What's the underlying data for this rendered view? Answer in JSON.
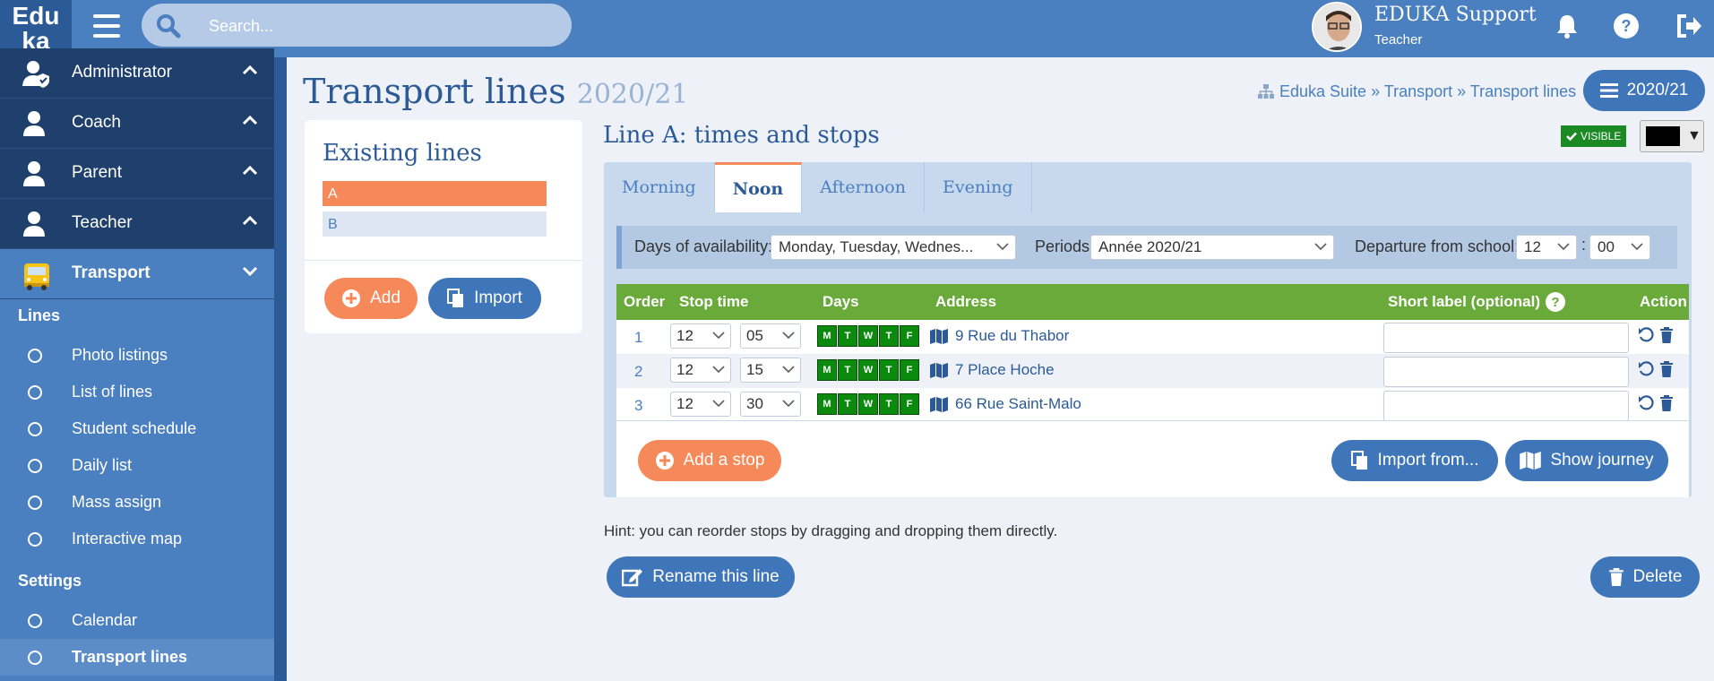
{
  "app": {
    "logo_line1": "Edu",
    "logo_line2": "ka",
    "search_placeholder": "Search...",
    "user_name": "EDUKA Support",
    "user_role": "Teacher",
    "accent": "#4a7fc0",
    "dark": "#1f3f6c",
    "orange": "#f5895a",
    "green": "#6aaa3a"
  },
  "sidebar": {
    "groups": [
      {
        "label": "Administrator",
        "icon": "user-shield-icon"
      },
      {
        "label": "Coach",
        "icon": "user-icon"
      },
      {
        "label": "Parent",
        "icon": "user-icon"
      },
      {
        "label": "Teacher",
        "icon": "user-icon"
      },
      {
        "label": "Transport",
        "icon": "bus-icon"
      }
    ],
    "lines_heading": "Lines",
    "lines_items": [
      "Photo listings",
      "List of lines",
      "Student schedule",
      "Daily list",
      "Mass assign",
      "Interactive map"
    ],
    "settings_heading": "Settings",
    "settings_items": [
      "Calendar",
      "Transport lines"
    ]
  },
  "page": {
    "title": "Transport lines",
    "year": "2020/21",
    "breadcrumb": "Eduka Suite » Transport » Transport lines",
    "year_button": "2020/21"
  },
  "existing_lines": {
    "title": "Existing lines",
    "items": [
      "A",
      "B"
    ],
    "add_label": "Add",
    "import_label": "Import"
  },
  "line": {
    "title": "Line A: times and stops",
    "visible_badge": "VISIBLE",
    "tabs": [
      "Morning",
      "Noon",
      "Afternoon",
      "Evening"
    ],
    "active_tab": "Noon",
    "filters": {
      "days_label": "Days of availability:",
      "days_value": "Monday, Tuesday, Wednes...",
      "periods_label": "Periods:",
      "periods_value": "Année 2020/21",
      "departure_label": "Departure from school:",
      "departure_hour": "12",
      "departure_min": "00"
    },
    "columns": [
      "Order",
      "Stop time",
      "Days",
      "Address",
      "Short label (optional)",
      "Action"
    ],
    "stops": [
      {
        "order": "1",
        "hour": "12",
        "min": "05",
        "days": [
          "M",
          "T",
          "W",
          "T",
          "F"
        ],
        "address": "9 Rue du Thabor"
      },
      {
        "order": "2",
        "hour": "12",
        "min": "15",
        "days": [
          "M",
          "T",
          "W",
          "T",
          "F"
        ],
        "address": "7 Place Hoche"
      },
      {
        "order": "3",
        "hour": "12",
        "min": "30",
        "days": [
          "M",
          "T",
          "W",
          "T",
          "F"
        ],
        "address": "66 Rue Saint-Malo"
      }
    ],
    "add_stop_label": "Add a stop",
    "import_from_label": "Import from...",
    "show_journey_label": "Show journey",
    "hint": "Hint: you can reorder stops by dragging and dropping them directly.",
    "rename_label": "Rename this line",
    "delete_label": "Delete"
  }
}
